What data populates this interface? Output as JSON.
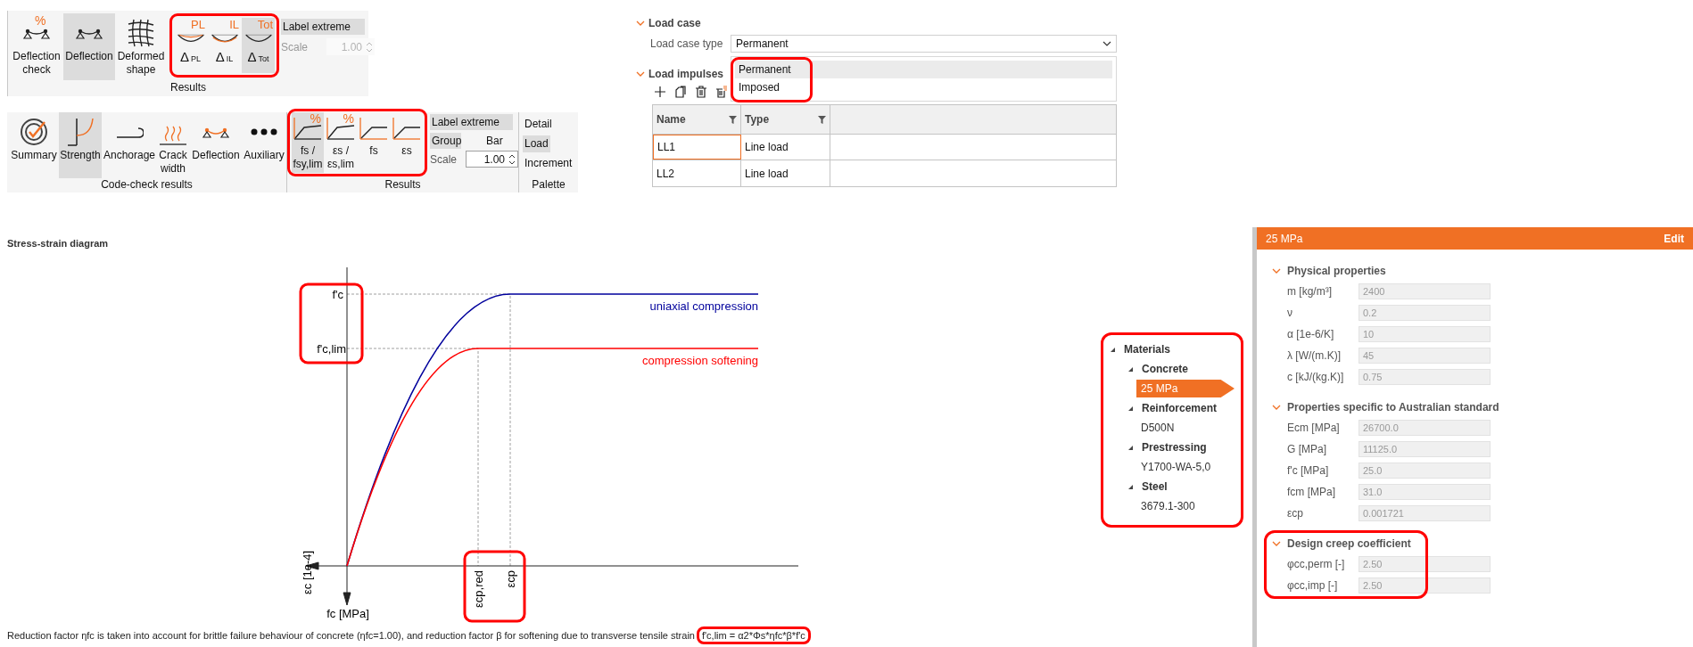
{
  "results_ribbon": {
    "group": "Results",
    "buttons": [
      {
        "kind": "deflection-check",
        "label": "Deflection check",
        "badge": "%",
        "selected": false
      },
      {
        "kind": "deflection",
        "label": "Deflection",
        "selected": true
      },
      {
        "kind": "deformed",
        "label": "Deformed shape",
        "selected": false
      }
    ],
    "delta_group": {
      "highlighted": true,
      "buttons": [
        {
          "kind": "pl",
          "tag": "PL",
          "symbol": "Δ",
          "sub": "PL",
          "selected": false
        },
        {
          "kind": "il",
          "tag": "IL",
          "symbol": "Δ",
          "sub": "IL",
          "selected": false
        },
        {
          "kind": "tot",
          "tag": "Tot",
          "symbol": "Δ",
          "sub": "Tot",
          "selected": true
        }
      ]
    },
    "label_extreme": {
      "label": "Label extreme",
      "selected": true
    },
    "scale": {
      "label": "Scale",
      "value": "1.00",
      "disabled": true
    }
  },
  "code_check_ribbon": {
    "tools_group": {
      "label": "Code-check results",
      "buttons": [
        {
          "kind": "summary",
          "label": "Summary",
          "selected": false
        },
        {
          "kind": "strength",
          "label": "Strength",
          "selected": true
        },
        {
          "kind": "anchorage",
          "label": "Anchorage",
          "selected": false
        },
        {
          "kind": "crack",
          "label": "Crack width",
          "selected": false
        },
        {
          "kind": "deflection",
          "label": "Deflection",
          "selected": false
        },
        {
          "kind": "auxiliary",
          "label": "Auxiliary",
          "selected": false
        }
      ]
    },
    "results_group": {
      "label": "Results",
      "highlighted": true,
      "buttons": [
        {
          "kind": "ratio",
          "label": "fs / fsy,lim",
          "badge": "%",
          "selected": true
        },
        {
          "kind": "ratio",
          "label": "εs / εs,lim",
          "badge": "%",
          "selected": false
        },
        {
          "kind": "plain",
          "label": "fs",
          "selected": false
        },
        {
          "kind": "plain",
          "label": "εs",
          "selected": false
        }
      ],
      "label_extreme": {
        "label": "Label extreme",
        "selected": true
      },
      "group": {
        "label": "Group",
        "value": "Bar",
        "selected": true
      },
      "scale": {
        "label": "Scale",
        "value": "1.00",
        "disabled": false
      }
    },
    "palette": {
      "label": "Palette",
      "items": [
        {
          "label": "Detail",
          "selected": false
        },
        {
          "label": "Load",
          "selected": true
        },
        {
          "label": "Increment",
          "selected": false
        }
      ]
    }
  },
  "load_case": {
    "title": "Load case",
    "expanded": true,
    "type_label": "Load case type",
    "type_value": "Permanent",
    "dropdown": {
      "highlighted": true,
      "options": [
        {
          "label": "Permanent",
          "selected": true
        },
        {
          "label": "Imposed",
          "selected": false
        }
      ]
    }
  },
  "load_impulses": {
    "title": "Load impulses",
    "expanded": true,
    "columns": [
      {
        "label": "Name"
      },
      {
        "label": "Type"
      }
    ],
    "rows": [
      {
        "name": "LL1",
        "type": "Line load",
        "focused": true
      },
      {
        "name": "LL2",
        "type": "Line load",
        "focused": false
      }
    ]
  },
  "diagram": {
    "title": "Stress-strain diagram",
    "y_labels": {
      "highlighted": true,
      "top": "f'c",
      "lower": "f'c,lim"
    },
    "x_labels": {
      "highlighted": true,
      "reduced": "εcp,red",
      "peak": "εcp"
    },
    "x_axis": "εc [1e-4]",
    "y_axis": "fc [MPa]",
    "curves": [
      {
        "name": "uniaxial compression",
        "color": "#00009c"
      },
      {
        "name": "compression softening",
        "color": "#ff0000"
      }
    ],
    "note": "Reduction factor ηfc is taken into account for brittle failure behaviour of concrete (ηfc=1.00), and reduction factor β for softening due to transverse tensile strain",
    "formula": {
      "text": "f'c,lim = α2*Φs*ηfc*β*f'c",
      "highlighted": true
    }
  },
  "materials_tree": {
    "highlighted": true,
    "items": [
      {
        "label": "Materials",
        "expanded": true,
        "children": [
          {
            "label": "Concrete",
            "expanded": true,
            "children": [
              {
                "label": "25 MPa",
                "selected": true
              }
            ]
          },
          {
            "label": "Reinforcement",
            "expanded": true,
            "children": [
              {
                "label": "D500N",
                "selected": false
              }
            ]
          },
          {
            "label": "Prestressing",
            "expanded": true,
            "children": [
              {
                "label": "Y1700-WA-5,0",
                "selected": false
              }
            ]
          },
          {
            "label": "Steel",
            "expanded": true,
            "children": [
              {
                "label": "3679.1-300",
                "selected": false
              }
            ]
          }
        ]
      }
    ]
  },
  "properties": {
    "title": "25 MPa",
    "action": "Edit",
    "sections": [
      {
        "title": "Physical properties",
        "expanded": true,
        "rows": [
          {
            "label": "m [kg/m³]",
            "value": "2400"
          },
          {
            "label": "ν",
            "value": "0.2"
          },
          {
            "label": "α [1e-6/K]",
            "value": "10"
          },
          {
            "label": "λ [W/(m.K)]",
            "value": "45"
          },
          {
            "label": "c [kJ/(kg.K)]",
            "value": "0.75"
          }
        ]
      },
      {
        "title": "Properties specific to Australian standard",
        "expanded": true,
        "rows": [
          {
            "label": "Ecm [MPa]",
            "value": "26700.0"
          },
          {
            "label": "G [MPa]",
            "value": "11125.0"
          },
          {
            "label": "f'c [MPa]",
            "value": "25.0"
          },
          {
            "label": "fcm [MPa]",
            "value": "31.0"
          },
          {
            "label": "εcp",
            "value": "0.001721"
          }
        ]
      },
      {
        "title": "Design creep coefficient",
        "expanded": true,
        "highlighted": true,
        "rows": [
          {
            "label": "φcc,perm [-]",
            "value": "2.50"
          },
          {
            "label": "φcc,imp [-]",
            "value": "2.50"
          }
        ]
      }
    ]
  }
}
